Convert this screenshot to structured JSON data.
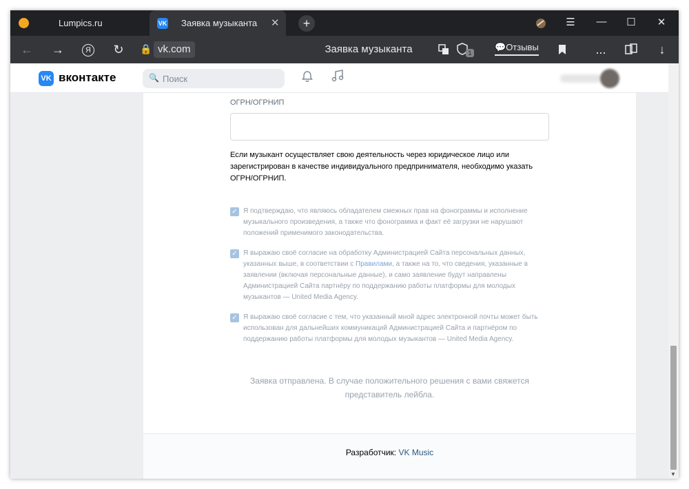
{
  "browser": {
    "tabs": [
      {
        "title": "Lumpics.ru",
        "active": false
      },
      {
        "title": "Заявка музыканта",
        "active": true
      }
    ],
    "new_tab": "+",
    "window_controls": {
      "menu": "☰",
      "minimize": "—",
      "maximize": "☐",
      "close": "✕"
    },
    "nav": {
      "back": "←",
      "forward": "→",
      "reload": "↻",
      "yandex": "Я"
    },
    "url": "vk.com",
    "page_title": "Заявка музыканта",
    "reviews_label": "Отзывы",
    "extension_badge": "1",
    "more_label": "...",
    "download_icon": "↓"
  },
  "vk_header": {
    "logo_letters": "VK",
    "brand": "вконтакте",
    "search_placeholder": "Поиск"
  },
  "form": {
    "ogrn_label": "ОГРН/ОГРНИП",
    "ogrn_value": "",
    "hint_text": "Если музыкант осуществляет свою деятельность через юридическое лицо или зарегистрирован в качестве индивидуального предпринимателя, необходимо указать ОГРН/ОГРНИП.",
    "checkboxes": [
      {
        "checked": true,
        "text": "Я подтверждаю, что являюсь обладателем смежных прав на фонограммы и исполнение музыкального произведения, а также что фонограмма и факт её загрузки не нарушают положений применимого законодательства."
      },
      {
        "checked": true,
        "text_before": "Я выражаю своё согласие на обработку Администрацией Сайта персональных данных, указанных выше, в соответствии с ",
        "link": "Правилами",
        "text_after": ", а также на то, что сведения, указанные в заявлении (включая персональные данные), и само заявление будут направлены Администрацией Сайта партнёру по поддержанию работы платформы для молодых музыкантов — United Media Agency."
      },
      {
        "checked": true,
        "text": "Я выражаю своё согласие с тем, что указанный мной адрес электронной почты может быть использован для дальнейших коммуникаций Администрацией Сайта и партнёром по поддержанию работы платформы для молодых музыкантов — United Media Agency."
      }
    ],
    "status_message": "Заявка отправлена. В случае положительного решения с вами свяжется представитель лейбла."
  },
  "footer": {
    "developer_label": "Разработчик: ",
    "developer_link": "VK Music"
  },
  "colors": {
    "vk_blue": "#2787f5",
    "page_bg": "#edeef0",
    "browser_dark": "#202124",
    "browser_toolbar": "#35363a"
  }
}
